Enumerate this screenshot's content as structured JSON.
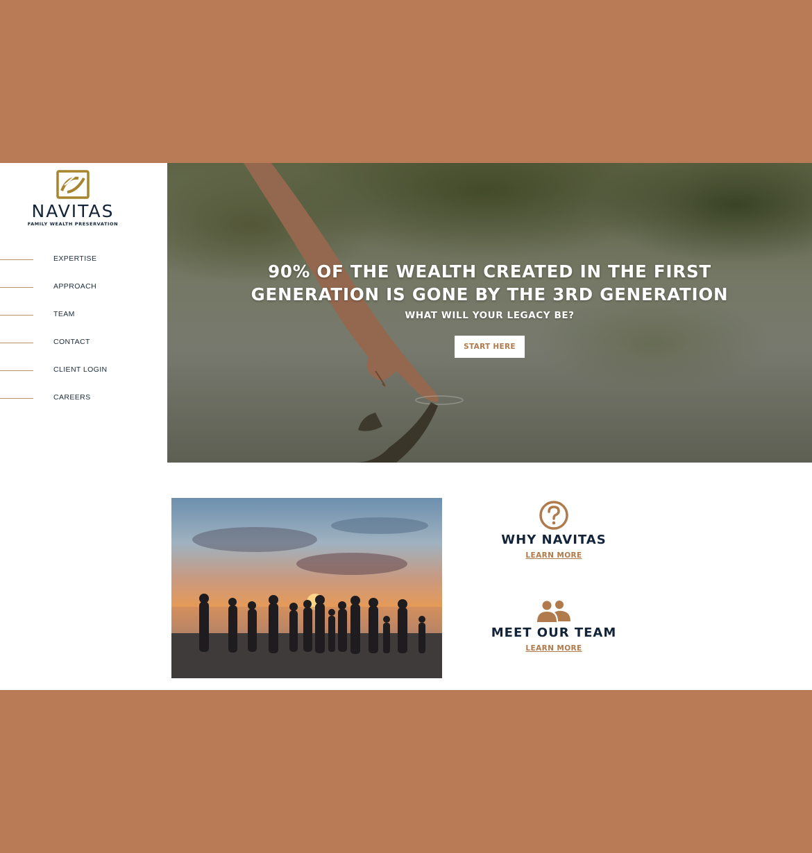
{
  "brand": {
    "name": "NAVITAS",
    "tagline": "FAMILY WEALTH PRESERVATION"
  },
  "nav": [
    {
      "label": "EXPERTISE"
    },
    {
      "label": "APPROACH"
    },
    {
      "label": "TEAM"
    },
    {
      "label": "CONTACT"
    },
    {
      "label": "CLIENT LOGIN"
    },
    {
      "label": "CAREERS"
    }
  ],
  "hero": {
    "title_line1": "90% OF THE WEALTH CREATED IN THE FIRST",
    "title_line2": "GENERATION IS GONE BY THE 3RD GENERATION",
    "subtitle": "WHAT WILL YOUR LEGACY BE?",
    "cta_label": "START HERE"
  },
  "features": [
    {
      "title": "WHY NAVITAS",
      "link": "LEARN MORE",
      "icon": "question-circle-icon"
    },
    {
      "title": "MEET OUR TEAM",
      "link": "LEARN MORE",
      "icon": "people-icon"
    }
  ],
  "colors": {
    "page_bg": "#b87b56",
    "navy": "#13233a",
    "accent": "#b07a4c",
    "gold": "#a8842e"
  }
}
